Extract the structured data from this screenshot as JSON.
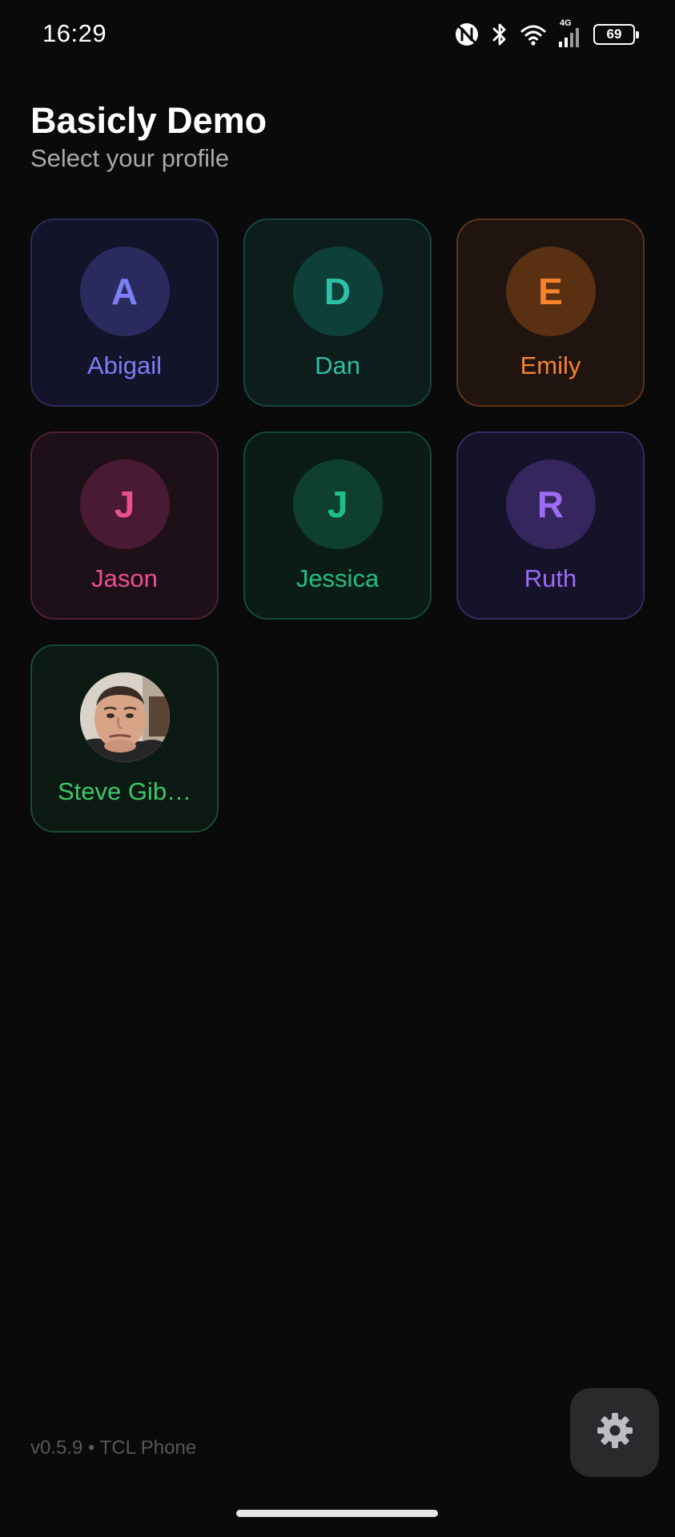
{
  "status_bar": {
    "time": "16:29",
    "network_tag": "4G",
    "battery_level": "69",
    "icons": [
      "nfc-icon",
      "bluetooth-icon",
      "wifi-icon",
      "cellular-signal-icon",
      "battery-icon"
    ]
  },
  "header": {
    "title": "Basicly Demo",
    "subtitle": "Select your profile"
  },
  "profiles": [
    {
      "name": "Abigail",
      "initial": "A",
      "type": "initial",
      "accent": "#7b7ef4",
      "card_bg": "#13132a",
      "card_border": "#2b2b57",
      "avatar_bg": "#2a2a5e"
    },
    {
      "name": "Dan",
      "initial": "D",
      "type": "initial",
      "accent": "#2dbfa8",
      "card_bg": "#0c1d1c",
      "card_border": "#16463f",
      "avatar_bg": "#0f3f39"
    },
    {
      "name": "Emily",
      "initial": "E",
      "type": "initial",
      "accent": "#f7842a",
      "card_bg": "#1f1410",
      "card_border": "#5a3318",
      "avatar_bg": "#5a3012"
    },
    {
      "name": "Jason",
      "initial": "J",
      "type": "initial",
      "accent": "#ec4e93",
      "card_bg": "#1d1018",
      "card_border": "#4f1f36",
      "avatar_bg": "#4a1a34"
    },
    {
      "name": "Jessica",
      "initial": "J",
      "type": "initial",
      "accent": "#1fbf85",
      "card_bg": "#0b1c16",
      "card_border": "#15473a",
      "avatar_bg": "#0f3f31"
    },
    {
      "name": "Ruth",
      "initial": "R",
      "type": "initial",
      "accent": "#9d6cf4",
      "card_bg": "#16122a",
      "card_border": "#342b5c",
      "avatar_bg": "#35265e"
    },
    {
      "name": "Steve Gib…",
      "initial": "",
      "type": "photo",
      "accent": "#3ec66b",
      "card_bg": "#0c1a13",
      "card_border": "#1b4a32",
      "avatar_bg": "#d9d4cc"
    }
  ],
  "footer": {
    "version": "v0.5.9 • TCL Phone",
    "settings_icon": "gear-icon"
  }
}
